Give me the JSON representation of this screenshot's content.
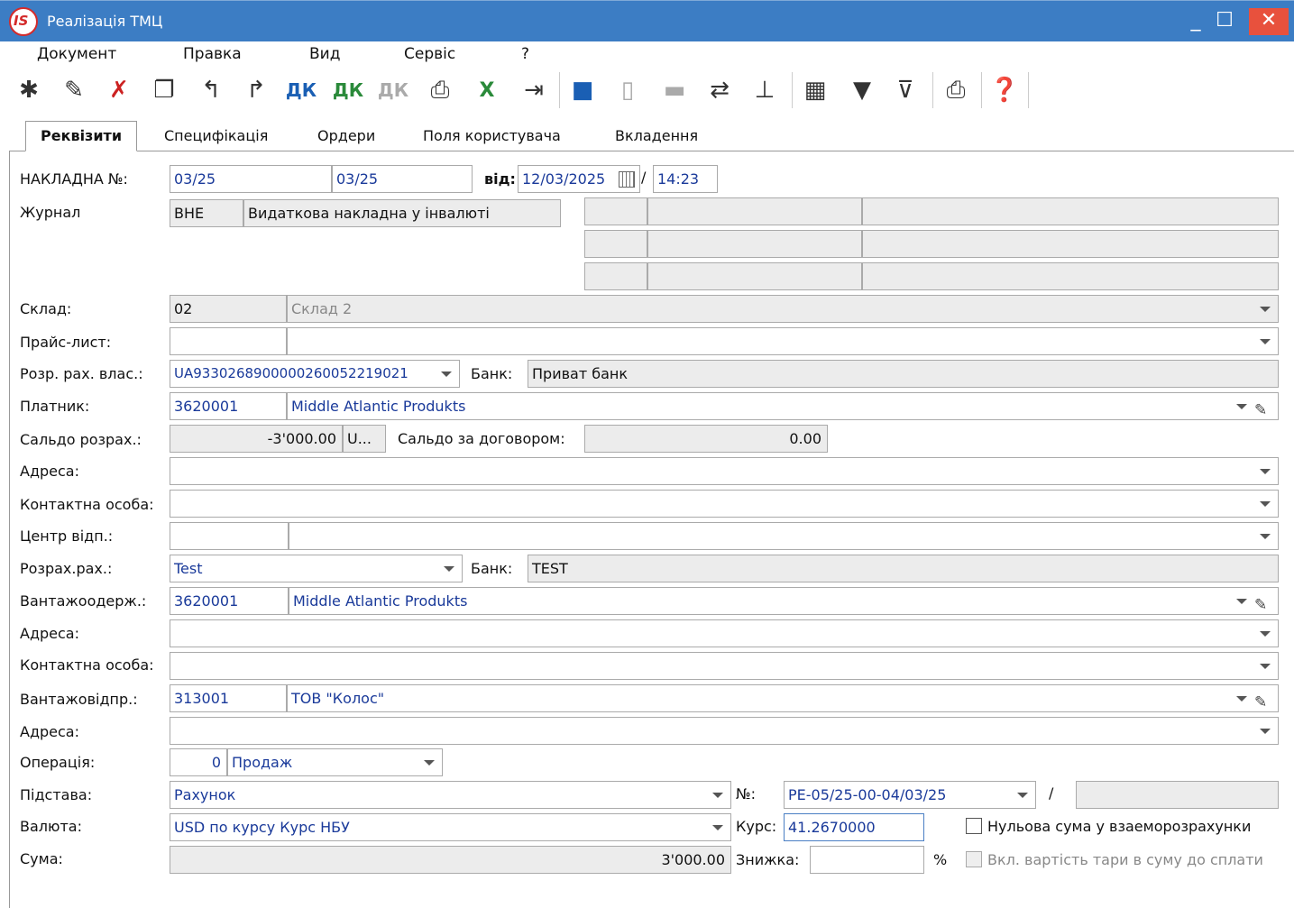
{
  "window": {
    "title": "Реалізація ТМЦ",
    "logo": "IS",
    "min": "_",
    "max": "☐",
    "close": "✕"
  },
  "menu": [
    "Документ",
    "Правка",
    "Вид",
    "Сервіс",
    "?"
  ],
  "toolbar_icons": [
    "add-new-icon",
    "edit-icon",
    "delete-icon",
    "copy-icon",
    "undo-icon",
    "redo-icon",
    "dk-icon",
    "dk-green-icon",
    "dk-gray-icon",
    "print-preview-icon",
    "excel-export-icon",
    "exit-icon",
    "save-icon",
    "book-icon",
    "folder-icon",
    "transfer-icon",
    "tree-icon",
    "grid-icon",
    "filter-icon",
    "clear-filter-icon",
    "printer-icon",
    "help-icon"
  ],
  "tabs": [
    "Реквізити",
    "Специфікація",
    "Ордери",
    "Поля користувача",
    "Вкладення"
  ],
  "form": {
    "invoice_label": "НАКЛАДНА №:",
    "invoice_no1": "03/25",
    "invoice_no2": "03/25",
    "from_label": "від:",
    "date": "12/03/2025",
    "slash": "/",
    "time": "14:23",
    "journal_label": "Журнал",
    "journal_code": "ВНЕ",
    "journal_name": "Видаткова накладна у інвалюті",
    "warehouse_label": "Склад:",
    "warehouse_code": "02",
    "warehouse_name": "Склад 2",
    "pricelist_label": "Прайс-лист:",
    "account_label": "Розр. рах. влас.:",
    "account": "UA933026890000026005221902​1",
    "bank_label": "Банк:",
    "bank": "Приват банк",
    "payer_label": "Платник:",
    "payer_code": "3620001",
    "payer_name": "Middle Atlantic Produkts",
    "balance_label": "Сальдо розрах.:",
    "balance": "-3'000.00",
    "balance_cur": "U...",
    "contract_balance_label": "Сальдо за договором:",
    "contract_balance": "0.00",
    "address_label": "Адреса:",
    "contact_label": "Контактна особа:",
    "center_label": "Центр відп.:",
    "calc_account_label": "Розрах.рах.:",
    "calc_account": "Test",
    "bank2_label": "Банк:",
    "bank2": "TEST",
    "consignee_label": "Вантажоодерж.:",
    "consignee_code": "3620001",
    "consignee_name": "Middle Atlantic Produkts",
    "address2_label": "Адреса:",
    "contact2_label": "Контактна особа:",
    "shipper_label": "Вантажовідпр.:",
    "shipper_code": "313001",
    "shipper_name": "ТОВ \"Колос\"",
    "address3_label": "Адреса:",
    "operation_label": "Операція:",
    "operation_code": "0",
    "operation_name": "Продаж",
    "basis_label": "Підстава:",
    "basis": "Рахунок",
    "no_label": "№:",
    "basis_no": "РЕ-05/25-00-04/03/25",
    "slash2": "/",
    "currency_label": "Валюта:",
    "currency": "USD по курсу Курс НБУ",
    "rate_label": "Курс:",
    "rate": "41.2670000",
    "zero_sum_label": "Нульова сума у взаеморозрахунки",
    "sum_label": "Сума:",
    "sum": "3'000.00",
    "discount_label": "Знижка:",
    "discount": "",
    "percent": "%",
    "tare_label": "Вкл. вартість тари в суму до сплати"
  }
}
